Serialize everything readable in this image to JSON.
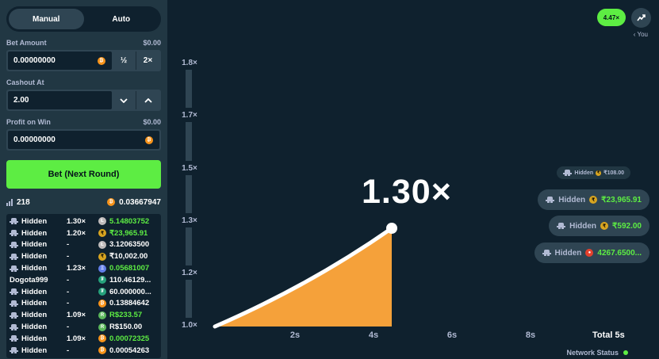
{
  "sidebar": {
    "tabs": [
      {
        "label": "Manual",
        "active": true
      },
      {
        "label": "Auto",
        "active": false
      }
    ],
    "bet_amount": {
      "label": "Bet Amount",
      "usd": "$0.00",
      "value": "0.00000000",
      "half_label": "½",
      "double_label": "2×",
      "currency_icon": "btc"
    },
    "cashout_at": {
      "label": "Cashout At",
      "value": "2.00"
    },
    "profit_on_win": {
      "label": "Profit on Win",
      "usd": "$0.00",
      "value": "0.00000000",
      "currency_icon": "btc"
    },
    "bet_button_label": "Bet (Next Round)",
    "player_count": "218",
    "total_bet": "0.03667947",
    "players": [
      {
        "name": "Hidden",
        "hidden": true,
        "mult": "1.30×",
        "coin": "ltc",
        "amount": "5.14803752",
        "win": true
      },
      {
        "name": "Hidden",
        "hidden": true,
        "mult": "1.20×",
        "coin": "inr",
        "amount": "₹23,965.91",
        "win": true
      },
      {
        "name": "Hidden",
        "hidden": true,
        "mult": "-",
        "coin": "ltc",
        "amount": "3.12063500",
        "win": false
      },
      {
        "name": "Hidden",
        "hidden": true,
        "mult": "-",
        "coin": "inr",
        "amount": "₹10,002.00",
        "win": false
      },
      {
        "name": "Hidden",
        "hidden": true,
        "mult": "1.23×",
        "coin": "eth",
        "amount": "0.05681007",
        "win": true
      },
      {
        "name": "Dogota999",
        "hidden": false,
        "mult": "-",
        "coin": "usdt",
        "amount": "110.46129...",
        "win": false
      },
      {
        "name": "Hidden",
        "hidden": true,
        "mult": "-",
        "coin": "usdt",
        "amount": "60.000000...",
        "win": false
      },
      {
        "name": "Hidden",
        "hidden": true,
        "mult": "-",
        "coin": "btc",
        "amount": "0.13884642",
        "win": false
      },
      {
        "name": "Hidden",
        "hidden": true,
        "mult": "1.09×",
        "coin": "brl",
        "amount": "R$233.57",
        "win": true
      },
      {
        "name": "Hidden",
        "hidden": true,
        "mult": "-",
        "coin": "brl",
        "amount": "R$150.00",
        "win": false
      },
      {
        "name": "Hidden",
        "hidden": true,
        "mult": "1.09×",
        "coin": "btc",
        "amount": "0.00072325",
        "win": true
      },
      {
        "name": "Hidden",
        "hidden": true,
        "mult": "-",
        "coin": "btc",
        "amount": "0.00054263",
        "win": false
      }
    ]
  },
  "main": {
    "last_crash": "4.47×",
    "you_label": "‹ You",
    "current_multiplier": "1.30×",
    "y_ticks": [
      "1.8×",
      "1.7×",
      "1.5×",
      "1.3×",
      "1.2×",
      "1.0×"
    ],
    "x_ticks": [
      "2s",
      "4s",
      "6s",
      "8s"
    ],
    "total_label": "Total 5s",
    "network_status_label": "Network Status",
    "cashouts": [
      {
        "name": "Hidden",
        "coin": "inr",
        "amount": "₹108.00",
        "size": "small"
      },
      {
        "name": "Hidden",
        "coin": "inr",
        "amount": "₹23,965.91",
        "size": "normal"
      },
      {
        "name": "Hidden",
        "coin": "inr",
        "amount": "₹592.00",
        "size": "normal"
      },
      {
        "name": "Hidden",
        "coin": "red",
        "amount": "4267.6500...",
        "size": "normal"
      }
    ],
    "colors": {
      "accent": "#5ded43",
      "curve_fill": "#f5a13a",
      "curve_stroke": "#ffffff",
      "panel": "#213743",
      "background": "#0f212e"
    }
  }
}
